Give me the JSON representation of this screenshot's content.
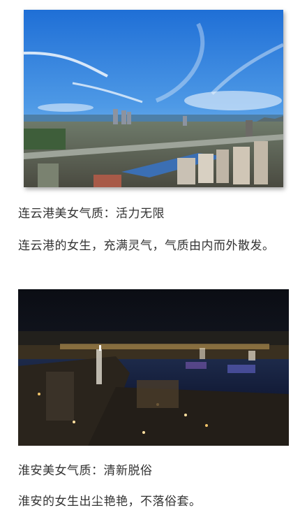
{
  "sections": [
    {
      "heading": "连云港美女气质：活力无限",
      "body": "连云港的女生，充满灵气，气质由内而外散发。"
    },
    {
      "heading": "淮安美女气质：清新脱俗",
      "body": "淮安的女生出尘艳艳，不落俗套。"
    }
  ]
}
